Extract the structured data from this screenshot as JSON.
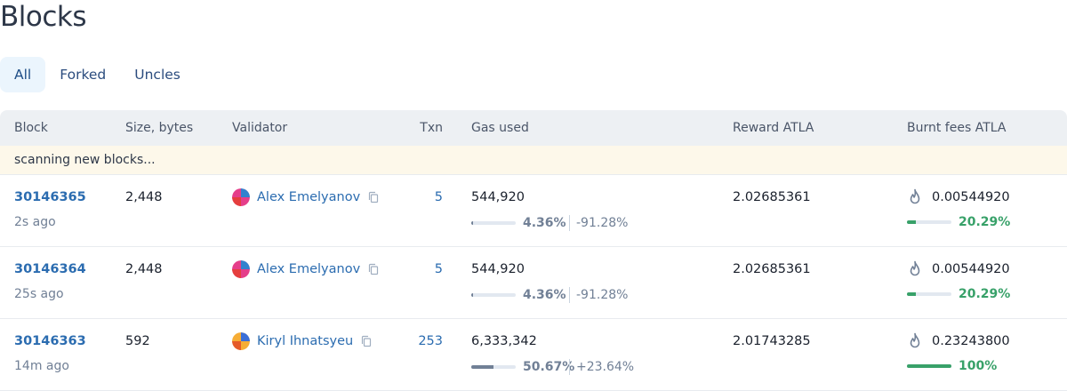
{
  "page": {
    "title": "Blocks"
  },
  "tabs": [
    {
      "label": "All",
      "active": true
    },
    {
      "label": "Forked",
      "active": false
    },
    {
      "label": "Uncles",
      "active": false
    }
  ],
  "table": {
    "headers": {
      "block": "Block",
      "size": "Size, bytes",
      "validator": "Validator",
      "txn": "Txn",
      "gas": "Gas used",
      "reward": "Reward ATLA",
      "burnt": "Burnt fees ATLA"
    },
    "scanning_text": "scanning new blocks...",
    "rows": [
      {
        "block": "30146365",
        "age": "2s ago",
        "size": "2,448",
        "validator": "Alex Emelyanov",
        "txn": "5",
        "gas_used": "544,920",
        "gas_pct": "4.36%",
        "gas_pct_value": 4.36,
        "gas_delta": "-91.28%",
        "reward": "2.02685361",
        "burnt": "0.00544920",
        "burnt_pct": "20.29%",
        "burnt_pct_value": 20.29
      },
      {
        "block": "30146364",
        "age": "25s ago",
        "size": "2,448",
        "validator": "Alex Emelyanov",
        "txn": "5",
        "gas_used": "544,920",
        "gas_pct": "4.36%",
        "gas_pct_value": 4.36,
        "gas_delta": "-91.28%",
        "reward": "2.02685361",
        "burnt": "0.00544920",
        "burnt_pct": "20.29%",
        "burnt_pct_value": 20.29
      },
      {
        "block": "30146363",
        "age": "14m ago",
        "size": "592",
        "validator": "Kiryl Ihnatsyeu",
        "txn": "253",
        "gas_used": "6,333,342",
        "gas_pct": "50.67%",
        "gas_pct_value": 50.67,
        "gas_delta": "+23.64%",
        "reward": "2.01743285",
        "burnt": "0.23243800",
        "burnt_pct": "100%",
        "burnt_pct_value": 100
      }
    ]
  },
  "icons": {
    "copy": "copy-icon",
    "fire": "fire-icon",
    "avatar": "validator-avatar"
  },
  "colors": {
    "link": "#2b6cb0",
    "accent_green": "#38a169",
    "tab_active_bg": "#ebf5fd",
    "scan_bg": "#fdf8ea"
  }
}
